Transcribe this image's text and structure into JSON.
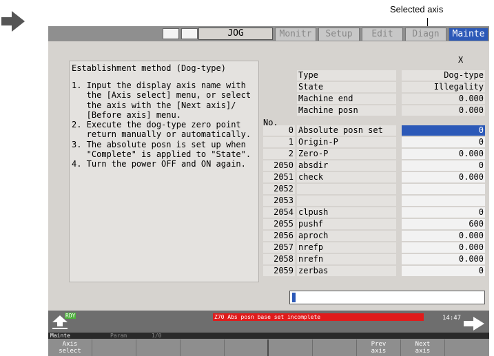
{
  "callout": {
    "label": "Selected axis"
  },
  "topbar": {
    "mode": "JOG",
    "tabs": [
      "Monitr",
      "Setup",
      "Edit",
      "Diagn",
      "Mainte"
    ],
    "active_tab": "Mainte"
  },
  "info": {
    "title": "Establishment method (Dog-type)",
    "lines": [
      "1. Input the display axis name with",
      "   the [Axis select] menu, or select",
      "   the axis with the [Next axis]/",
      "   [Before axis] menu.",
      "2. Execute the dog-type zero point",
      "   return manually or automatically.",
      "3. The absolute posn is set up when",
      "   \"Complete\" is applied to \"State\".",
      "4. Turn the power OFF and ON again."
    ]
  },
  "axis": {
    "name": "X"
  },
  "header": {
    "no_label": "No.",
    "rows": [
      {
        "label": "Type",
        "value": "Dog-type"
      },
      {
        "label": "State",
        "value": "Illegality"
      },
      {
        "label": "Machine end",
        "value": "0.000"
      },
      {
        "label": "Machine posn",
        "value": "0.000"
      }
    ]
  },
  "params": [
    {
      "no": "0",
      "name": "Absolute posn set",
      "value": "0",
      "selected": true
    },
    {
      "no": "1",
      "name": "Origin-P",
      "value": "0"
    },
    {
      "no": "2",
      "name": "Zero-P",
      "value": "0.000"
    },
    {
      "no": "2050",
      "name": "absdir",
      "value": "0"
    },
    {
      "no": "2051",
      "name": "check",
      "value": "0.000"
    },
    {
      "no": "2052",
      "name": "",
      "value": ""
    },
    {
      "no": "2053",
      "name": "",
      "value": ""
    },
    {
      "no": "2054",
      "name": "clpush",
      "value": "0"
    },
    {
      "no": "2055",
      "name": "pushf",
      "value": "600"
    },
    {
      "no": "2056",
      "name": "aproch",
      "value": "0.000"
    },
    {
      "no": "2057",
      "name": "nrefp",
      "value": "0.000"
    },
    {
      "no": "2058",
      "name": "nrefn",
      "value": "0.000"
    },
    {
      "no": "2059",
      "name": "zerbas",
      "value": "0"
    }
  ],
  "status": {
    "ready": "RDY",
    "alarm": "Z70  Abs posn base set incomplete",
    "time": "14:47"
  },
  "menu_path": {
    "current": "Mainte",
    "parent": "Param",
    "page": "1/0"
  },
  "fkeys": [
    {
      "l1": "Axis",
      "l2": "select"
    },
    {
      "l1": "",
      "l2": ""
    },
    {
      "l1": "",
      "l2": ""
    },
    {
      "l1": "",
      "l2": ""
    },
    {
      "l1": "",
      "l2": ""
    },
    {
      "l1": "",
      "l2": ""
    },
    {
      "l1": "",
      "l2": ""
    },
    {
      "l1": "Prev",
      "l2": "axis"
    },
    {
      "l1": "Next",
      "l2": "axis"
    },
    {
      "l1": "",
      "l2": ""
    }
  ],
  "colors": {
    "accent": "#2c59b8",
    "alarm": "#e01b1b",
    "ready": "#4caf3a",
    "screen_bg": "#d6d3cf"
  }
}
